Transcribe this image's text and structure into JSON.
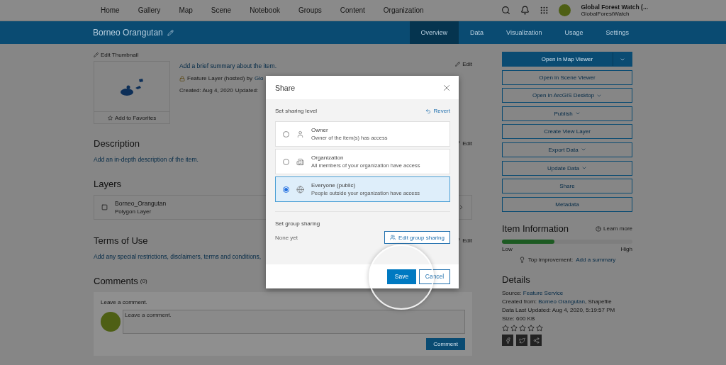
{
  "nav": {
    "items": [
      "Home",
      "Gallery",
      "Map",
      "Scene",
      "Notebook",
      "Groups",
      "Content",
      "Organization"
    ],
    "user_name": "Global Forest Watch (...",
    "user_org": "GlobalForestWatch"
  },
  "item_bar": {
    "title": "Borneo Orangutan",
    "tabs": [
      {
        "label": "Overview",
        "selected": true
      },
      {
        "label": "Data",
        "selected": false
      },
      {
        "label": "Visualization",
        "selected": false
      },
      {
        "label": "Usage",
        "selected": false
      },
      {
        "label": "Settings",
        "selected": false
      }
    ]
  },
  "overview": {
    "edit_thumbnail": "Edit Thumbnail",
    "favorite": "Add to Favorites",
    "summary_link": "Add a brief summary about the item.",
    "type_text": "Feature Layer (hosted) by",
    "owner_link": "Glo",
    "created": "Created: Aug 4, 2020",
    "updated": "Updated:",
    "edit_labels": [
      "Edit",
      "Edit",
      "Edit"
    ]
  },
  "description": {
    "heading": "Description",
    "link": "Add an in-depth description of the item."
  },
  "layers": {
    "heading": "Layers",
    "items": [
      {
        "name": "Borneo_Orangutan",
        "type": "Polygon Layer"
      }
    ]
  },
  "terms": {
    "heading": "Terms of Use",
    "link": "Add any special restrictions, disclaimers, terms and conditions,"
  },
  "comments": {
    "heading": "Comments",
    "count": "(0)",
    "prompt": "Leave a comment.",
    "placeholder": "Leave a comment.",
    "button": "Comment"
  },
  "actions": [
    {
      "label": "Open in Map Viewer",
      "kind": "primary",
      "dropdown": true
    },
    {
      "label": "Open in Scene Viewer",
      "kind": "outline",
      "dropdown": false
    },
    {
      "label": "Open in ArcGIS Desktop",
      "kind": "outline",
      "dropdown": true
    },
    {
      "label": "Publish",
      "kind": "outline",
      "dropdown": true
    },
    {
      "label": "Create View Layer",
      "kind": "outline",
      "dropdown": false
    },
    {
      "label": "Export Data",
      "kind": "outline",
      "dropdown": true
    },
    {
      "label": "Update Data",
      "kind": "outline",
      "dropdown": true
    },
    {
      "label": "Share",
      "kind": "outline",
      "dropdown": false
    },
    {
      "label": "Metadata",
      "kind": "outline",
      "dropdown": false
    }
  ],
  "item_information": {
    "heading": "Item Information",
    "learn_more": "Learn more",
    "level": 0.4,
    "low": "Low",
    "high": "High",
    "tip_label": "Top improvement:",
    "tip_link": "Add a summary"
  },
  "details": {
    "heading": "Details",
    "lines": [
      [
        {
          "text": "Source: ",
          "link": false
        },
        {
          "text": "Feature Service",
          "link": true
        }
      ],
      [
        {
          "text": "Created from: ",
          "link": false
        },
        {
          "text": "Borneo Orangutan",
          "link": true
        },
        {
          "text": ", Shapefile",
          "link": false
        }
      ],
      [
        {
          "text": "Data Last Updated: Aug 4, 2020, 5:19:57 PM",
          "link": false
        }
      ],
      [
        {
          "text": "Size: 600 KB",
          "link": false
        }
      ]
    ],
    "stars": 0
  },
  "share_dialog": {
    "title": "Share",
    "level_heading": "Set sharing level",
    "revert": "Revert",
    "options": [
      {
        "kind": "owner",
        "title": "Owner",
        "description": "Owner of the item(s) has access",
        "selected": false
      },
      {
        "kind": "organization",
        "title": "Organization",
        "description": "All members of your organization have access",
        "selected": false
      },
      {
        "kind": "everyone",
        "title": "Everyone (public)",
        "description": "People outside your organization have access",
        "selected": true
      }
    ],
    "group_heading": "Set group sharing",
    "group_status": "None yet",
    "edit_group": "Edit group sharing",
    "save": "Save",
    "cancel": "Cancel"
  }
}
